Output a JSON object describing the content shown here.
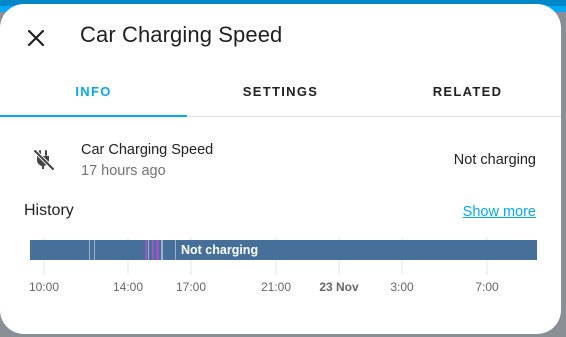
{
  "dialog": {
    "title": "Car Charging Speed",
    "close_icon": "close-icon"
  },
  "tabs": [
    {
      "label": "INFO",
      "active": true
    },
    {
      "label": "SETTINGS",
      "active": false
    },
    {
      "label": "RELATED",
      "active": false
    }
  ],
  "entity": {
    "name": "Car Charging Speed",
    "last_changed": "17 hours ago",
    "state": "Not charging",
    "icon": "ev-plug-off-icon"
  },
  "history": {
    "label": "History",
    "show_more": "Show more",
    "bar_state_label": "Not charging",
    "axis_labels": [
      "10:00",
      "14:00",
      "17:00",
      "21:00",
      "23 Nov",
      "3:00",
      "7:00"
    ],
    "bold_axis_label": "23 Nov",
    "colors": {
      "bar": "#46709a",
      "accent_light": "#9fb3c8",
      "accent_purple": "#9c55c6"
    }
  },
  "colors": {
    "primary": "#03a9f4",
    "text": "#212121",
    "secondary_text": "#727272"
  }
}
